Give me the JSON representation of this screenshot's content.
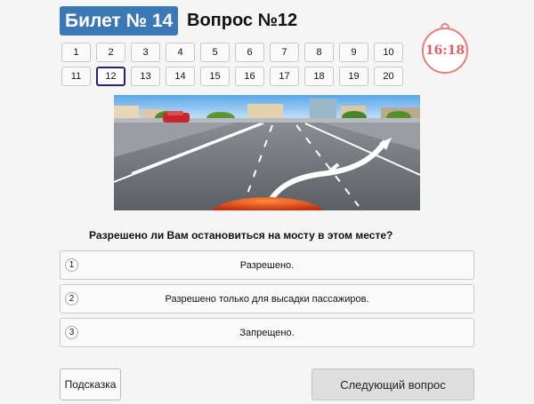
{
  "header": {
    "ticket_label": "Билет № 14",
    "question_label": "Вопрос №12"
  },
  "question_nav": {
    "items": [
      "1",
      "2",
      "3",
      "4",
      "5",
      "6",
      "7",
      "8",
      "9",
      "10",
      "11",
      "12",
      "13",
      "14",
      "15",
      "16",
      "17",
      "18",
      "19",
      "20"
    ],
    "active": "12"
  },
  "timer": {
    "value": "16:18",
    "color": "#e06060"
  },
  "question": {
    "text": "Разрешено ли Вам остановиться на мосту в этом месте?"
  },
  "answers": [
    {
      "num": "1",
      "text": "Разрешено."
    },
    {
      "num": "2",
      "text": "Разрешено только для высадки пассажиров."
    },
    {
      "num": "3",
      "text": "Запрещено."
    }
  ],
  "buttons": {
    "hint": "Подсказка",
    "next": "Следующий вопрос"
  },
  "colors": {
    "ticket_badge": "#3a79b5",
    "active_border": "#22227a",
    "timer_ring": "#ee7b7b"
  }
}
